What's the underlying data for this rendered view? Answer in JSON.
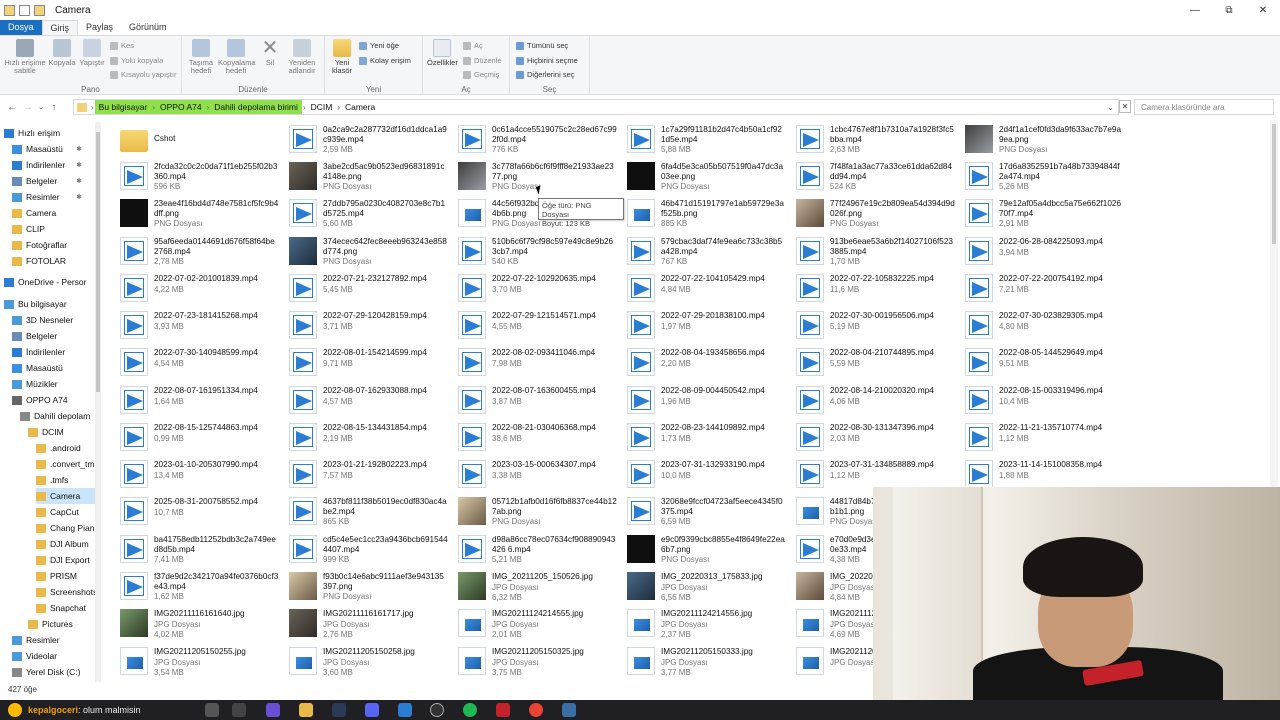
{
  "window": {
    "title": "Camera",
    "controls": [
      "—",
      "⧉",
      "✕"
    ]
  },
  "ribbon_tabs": [
    "Dosya",
    "Giriş",
    "Paylaş",
    "Görünüm"
  ],
  "ribbon": {
    "pano": {
      "label": "Pano",
      "pin": "Hızlı erişime sabitle",
      "copy": "Kopyala",
      "paste": "Yapıştır",
      "cut": "Kes",
      "copy_path": "Yolu kopyala",
      "paste_shortcut": "Kısayolu yapıştır"
    },
    "duzenle": {
      "label": "Düzenle",
      "move": "Taşıma hedefi",
      "copyto": "Kopyalama hedefi",
      "delete": "Sil",
      "rename": "Yeniden adlandır"
    },
    "yeni": {
      "label": "Yeni",
      "new_folder": "Yeni klasör",
      "new_item": "Yeni öğe",
      "easy_access": "Kolay erişim"
    },
    "ac": {
      "label": "Aç",
      "properties": "Özellikler",
      "open": "Aç",
      "edit": "Düzenle",
      "history": "Geçmiş"
    },
    "sec": {
      "label": "Seç",
      "select_all": "Tümünü seç",
      "select_none": "Hiçbirini seçme",
      "invert": "Diğerlerini seç"
    }
  },
  "address": {
    "crumbs": [
      "Bu bilgisayar",
      "OPPO A74",
      "Dahili depolama birimi",
      "DCIM",
      "Camera"
    ],
    "search_placeholder": "Camera klasöründe ara"
  },
  "nav": [
    {
      "label": "Hızlı erişim",
      "icon": "star-icon",
      "color": "#2a7dd2",
      "indent": 0,
      "pin": false
    },
    {
      "label": "Masaüstü",
      "icon": "desktop-icon",
      "color": "#3b8ee0",
      "indent": 1,
      "pin": true
    },
    {
      "label": "İndirilenler",
      "icon": "download-icon",
      "color": "#2a7dd2",
      "indent": 1,
      "pin": true
    },
    {
      "label": "Belgeler",
      "icon": "documents-icon",
      "color": "#6a8bb5",
      "indent": 1,
      "pin": true
    },
    {
      "label": "Resimler",
      "icon": "pictures-icon",
      "color": "#4a9ad8",
      "indent": 1,
      "pin": true
    },
    {
      "label": "Camera",
      "icon": "folder-icon",
      "color": "#e9b949",
      "indent": 1,
      "pin": false
    },
    {
      "label": "CLIP",
      "icon": "folder-icon",
      "color": "#e9b949",
      "indent": 1,
      "pin": false
    },
    {
      "label": "Fotoğraflar",
      "icon": "folder-icon",
      "color": "#e9b949",
      "indent": 1,
      "pin": false
    },
    {
      "label": "FOTOLAR",
      "icon": "folder-icon",
      "color": "#e9b949",
      "indent": 1,
      "pin": false
    },
    {
      "label": "OneDrive - Persor",
      "icon": "cloud-icon",
      "color": "#2a7dd2",
      "indent": 0,
      "pin": false
    },
    {
      "label": "Bu bilgisayar",
      "icon": "computer-icon",
      "color": "#4a9ad8",
      "indent": 0,
      "pin": false
    },
    {
      "label": "3D Nesneler",
      "icon": "cube-icon",
      "color": "#4a9ad8",
      "indent": 1,
      "pin": false
    },
    {
      "label": "Belgeler",
      "icon": "documents-icon",
      "color": "#6a8bb5",
      "indent": 1,
      "pin": false
    },
    {
      "label": "İndirilenler",
      "icon": "download-icon",
      "color": "#2a7dd2",
      "indent": 1,
      "pin": false
    },
    {
      "label": "Masaüstü",
      "icon": "desktop-icon",
      "color": "#3b8ee0",
      "indent": 1,
      "pin": false
    },
    {
      "label": "Müzikler",
      "icon": "music-icon",
      "color": "#4a9ad8",
      "indent": 1,
      "pin": false
    },
    {
      "label": "OPPO A74",
      "icon": "phone-icon",
      "color": "#666666",
      "indent": 1,
      "pin": false
    },
    {
      "label": "Dahili depolam",
      "icon": "drive-icon",
      "color": "#888888",
      "indent": 2,
      "pin": false
    },
    {
      "label": "DCIM",
      "icon": "folder-icon",
      "color": "#e9b949",
      "indent": 3,
      "pin": false
    },
    {
      "label": ".android",
      "icon": "folder-icon",
      "color": "#e9b949",
      "indent": 4,
      "pin": false
    },
    {
      "label": ".convert_tm",
      "icon": "folder-icon",
      "color": "#e9b949",
      "indent": 4,
      "pin": false
    },
    {
      "label": ".tmfs",
      "icon": "folder-icon",
      "color": "#e9b949",
      "indent": 4,
      "pin": false
    },
    {
      "label": "Camera",
      "icon": "folder-icon",
      "color": "#e9b949",
      "indent": 4,
      "pin": false,
      "selected": true
    },
    {
      "label": "CapCut",
      "icon": "folder-icon",
      "color": "#e9b949",
      "indent": 4,
      "pin": false
    },
    {
      "label": "Chang Pian",
      "icon": "folder-icon",
      "color": "#e9b949",
      "indent": 4,
      "pin": false
    },
    {
      "label": "DJI Album",
      "icon": "folder-icon",
      "color": "#e9b949",
      "indent": 4,
      "pin": false
    },
    {
      "label": "DJI Export",
      "icon": "folder-icon",
      "color": "#e9b949",
      "indent": 4,
      "pin": false
    },
    {
      "label": "PRISM",
      "icon": "folder-icon",
      "color": "#e9b949",
      "indent": 4,
      "pin": false
    },
    {
      "label": "Screenshots",
      "icon": "folder-icon",
      "color": "#e9b949",
      "indent": 4,
      "pin": false
    },
    {
      "label": "Snapchat",
      "icon": "folder-icon",
      "color": "#e9b949",
      "indent": 4,
      "pin": false
    },
    {
      "label": "Pictures",
      "icon": "folder-icon",
      "color": "#e9b949",
      "indent": 3,
      "pin": false
    },
    {
      "label": "Resimler",
      "icon": "pictures-icon",
      "color": "#4a9ad8",
      "indent": 1,
      "pin": false
    },
    {
      "label": "Videolar",
      "icon": "video-icon",
      "color": "#4a9ad8",
      "indent": 1,
      "pin": false
    },
    {
      "label": "Yerel Disk (C:)",
      "icon": "drive-icon",
      "color": "#888888",
      "indent": 1,
      "pin": false
    }
  ],
  "files": [
    [
      "Cshot",
      "",
      "folder"
    ],
    [
      "0a2ca9c2a287732df16d1ddca1a9c939e.mp4",
      "2,59 MB",
      "vid"
    ],
    [
      "0c61a4cce5519075c2c28ed67c992f0d.mp4",
      "776 KB",
      "vid"
    ],
    [
      "1c7a29f91181b2d47c4b50a1cf921d5e.mp4",
      "5,88 MB",
      "vid"
    ],
    [
      "1cbc4767e8f1b7310a7a1928f3fc5bba.mp4",
      "2,63 MB",
      "vid"
    ],
    [
      "2d4f1a1cef0fd3da9f633ac7b7e9a9ea.png",
      "PNG Dosyası",
      "th2"
    ],
    [
      "2fcda32c0c2c0da71f1eb255f02b3360.mp4",
      "596 KB",
      "vid"
    ],
    [
      "3abe2cd5ac9b0523ed96831891c4148e.png",
      "PNG Dosyası",
      "th1"
    ],
    [
      "3c778fa66b6cf6f9fff8e21933ae2377.png",
      "PNG Dosyası",
      "th2"
    ],
    [
      "6fa4d5e3ca05b507519f0a47dc3a03ee.png",
      "PNG Dosyası",
      "th3"
    ],
    [
      "7f48fa1a3ac77a33ce61dda62d84dd94.mp4",
      "524 KB",
      "vid"
    ],
    [
      "17d6a8352591b7a48b73394844f2a474.mp4",
      "5,26 MB",
      "vid"
    ],
    [
      "23eae4f16bd4d748e7581cf5fc9b4dff.png",
      "PNG Dosyası",
      "th3"
    ],
    [
      "27ddb795a0230c4082703e8c7b1d5725.mp4",
      "5,60 MB",
      "vid"
    ],
    [
      "44c56f932bd7d5ad6cd7d5ab4e7c4b6b.png",
      "PNG Dosyası",
      "pngdoc"
    ],
    [
      "46b471d15191797e1ab59729e3af525b.png",
      "885 KB",
      "pngdoc"
    ],
    [
      "77f24967e19c2b809ea54d394d9d026f.png",
      "PNG Dosyası",
      "th4"
    ],
    [
      "79e12af05a4dbcc5a75e662f102670f7.mp4",
      "2,91 MB",
      "vid"
    ],
    [
      "95af6eeda0144691d676f58f64be2768.mp4",
      "2,78 MB",
      "vid"
    ],
    [
      "374ecec642fec8eeeb963243e858d774.png",
      "PNG Dosyası",
      "th5"
    ],
    [
      "510b6c6f79cf98c597e49c8e9b263cb7.mp4",
      "540 KB",
      "vid"
    ],
    [
      "579cbac3daf74fe9ea6c733c38b5a428.mp4",
      "767 KB",
      "vid"
    ],
    [
      "913be6eae53a6b2f14027106f5233885.mp4",
      "1,70 MB",
      "vid"
    ],
    [
      "2022-06-28-084225093.mp4",
      "3,94 MB",
      "vid"
    ],
    [
      "2022-07-02-201001839.mp4",
      "4,22 MB",
      "vid"
    ],
    [
      "2022-07-21-232127892.mp4",
      "5,45 MB",
      "vid"
    ],
    [
      "2022-07-22-102920635.mp4",
      "3,70 MB",
      "vid"
    ],
    [
      "2022-07-22-104105429.mp4",
      "4,84 MB",
      "vid"
    ],
    [
      "2022-07-22-105832225.mp4",
      "11,6 MB",
      "vid"
    ],
    [
      "2022-07-22-200754192.mp4",
      "7,21 MB",
      "vid"
    ],
    [
      "2022-07-23-181415268.mp4",
      "3,93 MB",
      "vid"
    ],
    [
      "2022-07-29-120428159.mp4",
      "3,71 MB",
      "vid"
    ],
    [
      "2022-07-29-121514571.mp4",
      "4,55 MB",
      "vid"
    ],
    [
      "2022-07-29-201838100.mp4",
      "1,97 MB",
      "vid"
    ],
    [
      "2022-07-30-001956506.mp4",
      "5,19 MB",
      "vid"
    ],
    [
      "2022-07-30-023829305.mp4",
      "4,80 MB",
      "vid"
    ],
    [
      "2022-07-30-140948599.mp4",
      "4,54 MB",
      "vid"
    ],
    [
      "2022-08-01-154214599.mp4",
      "9,71 MB",
      "vid"
    ],
    [
      "2022-08-02-093411046.mp4",
      "7,98 MB",
      "vid"
    ],
    [
      "2022-08-04-193458656.mp4",
      "2,20 MB",
      "vid"
    ],
    [
      "2022-08-04-210744895.mp4",
      "5,59 MB",
      "vid"
    ],
    [
      "2022-08-05-144529649.mp4",
      "9,51 MB",
      "vid"
    ],
    [
      "2022-08-07-161951334.mp4",
      "1,64 MB",
      "vid"
    ],
    [
      "2022-08-07-162933088.mp4",
      "4,57 MB",
      "vid"
    ],
    [
      "2022-08-07-163600455.mp4",
      "3,87 MB",
      "vid"
    ],
    [
      "2022-08-09-004450542.mp4",
      "1,96 MB",
      "vid"
    ],
    [
      "2022-08-14-210020320.mp4",
      "4,06 MB",
      "vid"
    ],
    [
      "2022-08-15-003319496.mp4",
      "10,4 MB",
      "vid"
    ],
    [
      "2022-08-15-125744863.mp4",
      "0,99 MB",
      "vid"
    ],
    [
      "2022-08-15-134431854.mp4",
      "2,19 MB",
      "vid"
    ],
    [
      "2022-08-21-030406368.mp4",
      "38,6 MB",
      "vid"
    ],
    [
      "2022-08-23-144109892.mp4",
      "1,73 MB",
      "vid"
    ],
    [
      "2022-08-30-131347396.mp4",
      "2,03 MB",
      "vid"
    ],
    [
      "2022-11-21-135710774.mp4",
      "1,12 MB",
      "vid"
    ],
    [
      "2023-01-10-205307990.mp4",
      "13,4 MB",
      "vid"
    ],
    [
      "2023-01-21-192802223.mp4",
      "7,57 MB",
      "vid"
    ],
    [
      "2023-03-15-000634307.mp4",
      "3,38 MB",
      "vid"
    ],
    [
      "2023-07-31-132933190.mp4",
      "10,0 MB",
      "vid"
    ],
    [
      "2023-07-31-134858889.mp4",
      "1,12 MB",
      "vid"
    ],
    [
      "2023-11-14-151008358.mp4",
      "1,88 MB",
      "vid"
    ],
    [
      "2025-08-31-200758552.mp4",
      "10,7 MB",
      "vid"
    ],
    [
      "4637bf811f38b5019ec0df830ac4abe2.mp4",
      "865 KB",
      "vid"
    ],
    [
      "05712b1afb0d16f6fb8837ce44b127ab.png",
      "PNG Dosyası",
      "th6"
    ],
    [
      "32068e9fccf04723af5eece4345f0375.mp4",
      "6,59 MB",
      "vid"
    ],
    [
      "44817d84b7f8b8da9b6e93ba7c8cb1b1.png",
      "PNG Dosyası",
      "pngdoc"
    ],
    [
      "",
      "",
      ""
    ],
    [
      "ba41758edb11252bdb3c2a749eed8d5b.mp4",
      "7,41 MB",
      "vid"
    ],
    [
      "cd5c4e5ec1cc23a9436bcb6915444407.mp4",
      "999 KB",
      "vid"
    ],
    [
      "d98a86cc78ec07634cf908890943426 6.mp4",
      "5,21 MB",
      "vid"
    ],
    [
      "e9c0f9399cbc8855e4f8649fe22ea6b7.png",
      "PNG Dosyası",
      "th3"
    ],
    [
      "e70d0e9d3e2f1c7b8a5d4c3b2a1f0e33.mp4",
      "4,38 MB",
      "vid"
    ],
    [
      "",
      "",
      ""
    ],
    [
      "f37de9d2c342170a94fe0376b0cf3e43.mp4",
      "1,62 MB",
      "vid"
    ],
    [
      "f93b0c14e6abc9111aef3e943135397.png",
      "PNG Dosyası",
      "th6"
    ],
    [
      "IMG_20211205_150526.jpg",
      "JPG Dosyası",
      "th7"
    ],
    [
      "IMG_20220313_175833.jpg",
      "JPG Dosyası",
      "th5"
    ],
    [
      "IMG_20220123",
      "JPG Dosyası",
      "th4"
    ],
    [
      "",
      "",
      ""
    ],
    [
      "IMG20211116161640.jpg",
      "JPG Dosyası",
      "th7"
    ],
    [
      "IMG20211116161717.jpg",
      "JPG Dosyası",
      "th1"
    ],
    [
      "IMG20211124214555.jpg",
      "JPG Dosyası",
      "pngdoc"
    ],
    [
      "IMG20211124214556.jpg",
      "JPG Dosyası",
      "pngdoc"
    ],
    [
      "IMG20211124",
      "JPG Dosyası",
      "pngdoc"
    ],
    [
      "",
      "",
      ""
    ],
    [
      "IMG20211205150255.jpg",
      "JPG Dosyası",
      "pngdoc"
    ],
    [
      "IMG20211205150258.jpg",
      "JPG Dosyası",
      "pngdoc"
    ],
    [
      "IMG20211205150325.jpg",
      "JPG Dosyası",
      "pngdoc"
    ],
    [
      "IMG20211205150333.jpg",
      "JPG Dosyası",
      "pngdoc"
    ],
    [
      "IMG20211205",
      "JPG Dosyası",
      "pngdoc"
    ],
    [
      "",
      "",
      ""
    ]
  ],
  "file_subs": {
    "2": "2,01 MB",
    "3": "2,37 MB",
    "4": "4,69 MB"
  },
  "extra_sizes": {
    "row8": [
      "4,02 MB",
      "2,76 MB",
      "2,01 MB",
      "2,37 MB",
      "4,69 MB"
    ],
    "row9": [
      "3,54 MB",
      "3,60 MB",
      "3,75 MB",
      "3,77 MB"
    ],
    "row7": [
      "",
      "",
      "6,32 MB",
      "6,56 MB"
    ]
  },
  "tooltip": {
    "line1": "Öğe türü: PNG Dosyası",
    "line2": "Boyut: 123 KB"
  },
  "status": {
    "count": "427 öğe"
  },
  "taskbar": {
    "user": "kepalgoceri",
    "text": ": olum malmisin"
  }
}
